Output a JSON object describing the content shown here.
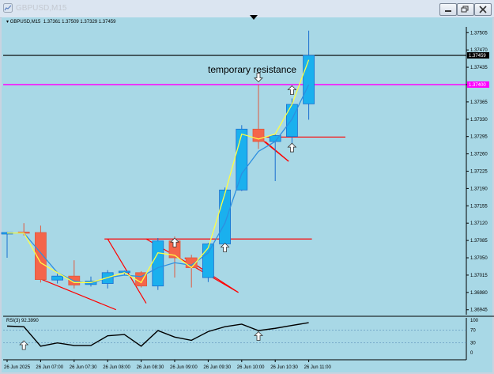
{
  "window": {
    "title": "GBPUSD,M15"
  },
  "header": {
    "symbol": "GBPUSD,M15",
    "ohlc": "1.37361 1.37509 1.37329 1.37459"
  },
  "annotation": {
    "text": "temporary resistance"
  },
  "price_axis": {
    "labels": [
      "1.37505",
      "1.37470",
      "1.37435",
      "1.37400",
      "1.37365",
      "1.37330",
      "1.37295",
      "1.37260",
      "1.37225",
      "1.37190",
      "1.37155",
      "1.37120",
      "1.37085",
      "1.37050",
      "1.37015",
      "1.36980",
      "1.36945"
    ],
    "bid_label": "1.37459",
    "level_label": "1.37400",
    "bid_color": "#000000",
    "level_color": "#ff00ff"
  },
  "time_axis": {
    "labels": [
      "26 Jun 2025",
      "26 Jun 07:00",
      "26 Jun 07:30",
      "26 Jun 08:00",
      "26 Jun 08:30",
      "26 Jun 09:00",
      "26 Jun 09:30",
      "26 Jun 10:00",
      "26 Jun 10:30",
      "26 Jun 11:00"
    ]
  },
  "rsi": {
    "label": "RSI(3) 92.3990",
    "levels": [
      "100",
      "70",
      "30",
      "0"
    ]
  },
  "chart_data": {
    "type": "candlestick",
    "x_label_step": 2,
    "ylim": [
      1.36935,
      1.37515
    ],
    "colors": {
      "bull": "#1ab0ee",
      "bear": "#f4654a",
      "background": "#a8d8e6",
      "trend": "#ff0000",
      "ma_fast": "#ffff44",
      "ma_slow": "#2d8fe0"
    },
    "candles": [
      {
        "o": 1.37098,
        "h": 1.37102,
        "l": 1.3705,
        "c": 1.37101
      },
      {
        "o": 1.37102,
        "h": 1.3712,
        "l": 1.37095,
        "c": 1.37101
      },
      {
        "o": 1.37101,
        "h": 1.37115,
        "l": 1.37,
        "c": 1.37006
      },
      {
        "o": 1.37005,
        "h": 1.37018,
        "l": 1.36998,
        "c": 1.37013
      },
      {
        "o": 1.37013,
        "h": 1.37045,
        "l": 1.36988,
        "c": 1.36995
      },
      {
        "o": 1.36996,
        "h": 1.37012,
        "l": 1.36992,
        "c": 1.37003
      },
      {
        "o": 1.36998,
        "h": 1.37025,
        "l": 1.36988,
        "c": 1.3702
      },
      {
        "o": 1.3702,
        "h": 1.37024,
        "l": 1.37016,
        "c": 1.37023
      },
      {
        "o": 1.3702,
        "h": 1.37023,
        "l": 1.3699,
        "c": 1.36993
      },
      {
        "o": 1.36993,
        "h": 1.3709,
        "l": 1.36985,
        "c": 1.37084
      },
      {
        "o": 1.37084,
        "h": 1.37093,
        "l": 1.3701,
        "c": 1.3705
      },
      {
        "o": 1.3705,
        "h": 1.37056,
        "l": 1.3699,
        "c": 1.3703
      },
      {
        "o": 1.3701,
        "h": 1.3708,
        "l": 1.37001,
        "c": 1.37078
      },
      {
        "o": 1.37078,
        "h": 1.37192,
        "l": 1.3707,
        "c": 1.37187
      },
      {
        "o": 1.37187,
        "h": 1.37318,
        "l": 1.37185,
        "c": 1.3731
      },
      {
        "o": 1.3731,
        "h": 1.374,
        "l": 1.3727,
        "c": 1.37285
      },
      {
        "o": 1.37285,
        "h": 1.37301,
        "l": 1.37205,
        "c": 1.37297
      },
      {
        "o": 1.37295,
        "h": 1.37372,
        "l": 1.3728,
        "c": 1.3736
      },
      {
        "o": 1.37361,
        "h": 1.37509,
        "l": 1.37329,
        "c": 1.37459
      }
    ],
    "ma_fast": [
      1.371,
      1.371,
      1.3704,
      1.3702,
      1.37,
      1.37,
      1.3701,
      1.3702,
      1.37,
      1.3706,
      1.37055,
      1.3703,
      1.3707,
      1.3718,
      1.373,
      1.3729,
      1.373,
      1.3736,
      1.3745
    ],
    "ma_slow": [
      1.371,
      1.371,
      1.3706,
      1.3702,
      1.37003,
      1.36998,
      1.3701,
      1.37015,
      1.37012,
      1.3703,
      1.3704,
      1.37035,
      1.3706,
      1.3712,
      1.3722,
      1.37265,
      1.37285,
      1.3733,
      1.374
    ],
    "rsi_values": [
      82,
      80,
      20,
      30,
      22,
      22,
      52,
      56,
      20,
      68,
      48,
      38,
      65,
      80,
      88,
      68,
      75,
      84,
      92.399
    ],
    "horizontal_lines": [
      {
        "price": 1.37459,
        "color": "#000000",
        "full": true
      },
      {
        "price": 1.374,
        "color": "#ff00ff",
        "full": true
      },
      {
        "price": 1.37088,
        "color": "#ff0000",
        "from": 6,
        "to": 18
      },
      {
        "price": 1.37294,
        "color": "#ff0000",
        "from": 15,
        "to": 20
      }
    ],
    "trend_lines": [
      {
        "x1": 1.8,
        "p1": 1.3701,
        "x2": 6.5,
        "p2": 1.36945
      },
      {
        "x1": 6.0,
        "p1": 1.37088,
        "x2": 8.3,
        "p2": 1.36958
      },
      {
        "x1": 8.3,
        "p1": 1.37088,
        "x2": 13.8,
        "p2": 1.3698
      },
      {
        "x1": 10.6,
        "p1": 1.3705,
        "x2": 13.8,
        "p2": 1.3698
      },
      {
        "x1": 15.0,
        "p1": 1.37294,
        "x2": 16.8,
        "p2": 1.37245
      },
      {
        "x1": 15.4,
        "p1": 1.37285,
        "x2": 16.8,
        "p2": 1.37245
      }
    ],
    "markers": [
      {
        "i": 1,
        "pane": "rsi",
        "value": 22,
        "dir": "up"
      },
      {
        "i": 10,
        "price": 1.3708,
        "dir": "up"
      },
      {
        "i": 13,
        "price": 1.3707,
        "dir": "up"
      },
      {
        "i": 15,
        "price": 1.37415,
        "dir": "down"
      },
      {
        "i": 15,
        "pane": "rsi",
        "value": 50,
        "dir": "up"
      },
      {
        "i": 17,
        "price": 1.37272,
        "dir": "up"
      },
      {
        "i": 17,
        "price": 1.37388,
        "dir": "up"
      }
    ]
  }
}
